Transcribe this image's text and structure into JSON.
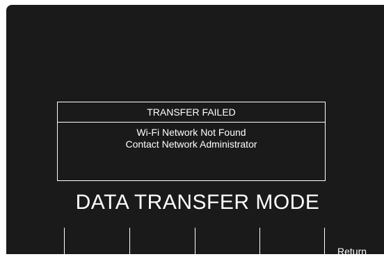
{
  "dialog": {
    "title": "TRANSFER FAILED",
    "message_line1": "Wi-Fi Network Not Found",
    "message_line2": "Contact Network Administrator"
  },
  "mode": {
    "title": "DATA TRANSFER MODE"
  },
  "softkeys": {
    "key1_label": "",
    "key2_label": "",
    "key3_label": "",
    "key4_label": "",
    "key5_label": "",
    "return_label": "Return"
  },
  "colors": {
    "screen_background": "#1a1a1a",
    "foreground": "#ffffff",
    "page_background": "#ffffff"
  }
}
